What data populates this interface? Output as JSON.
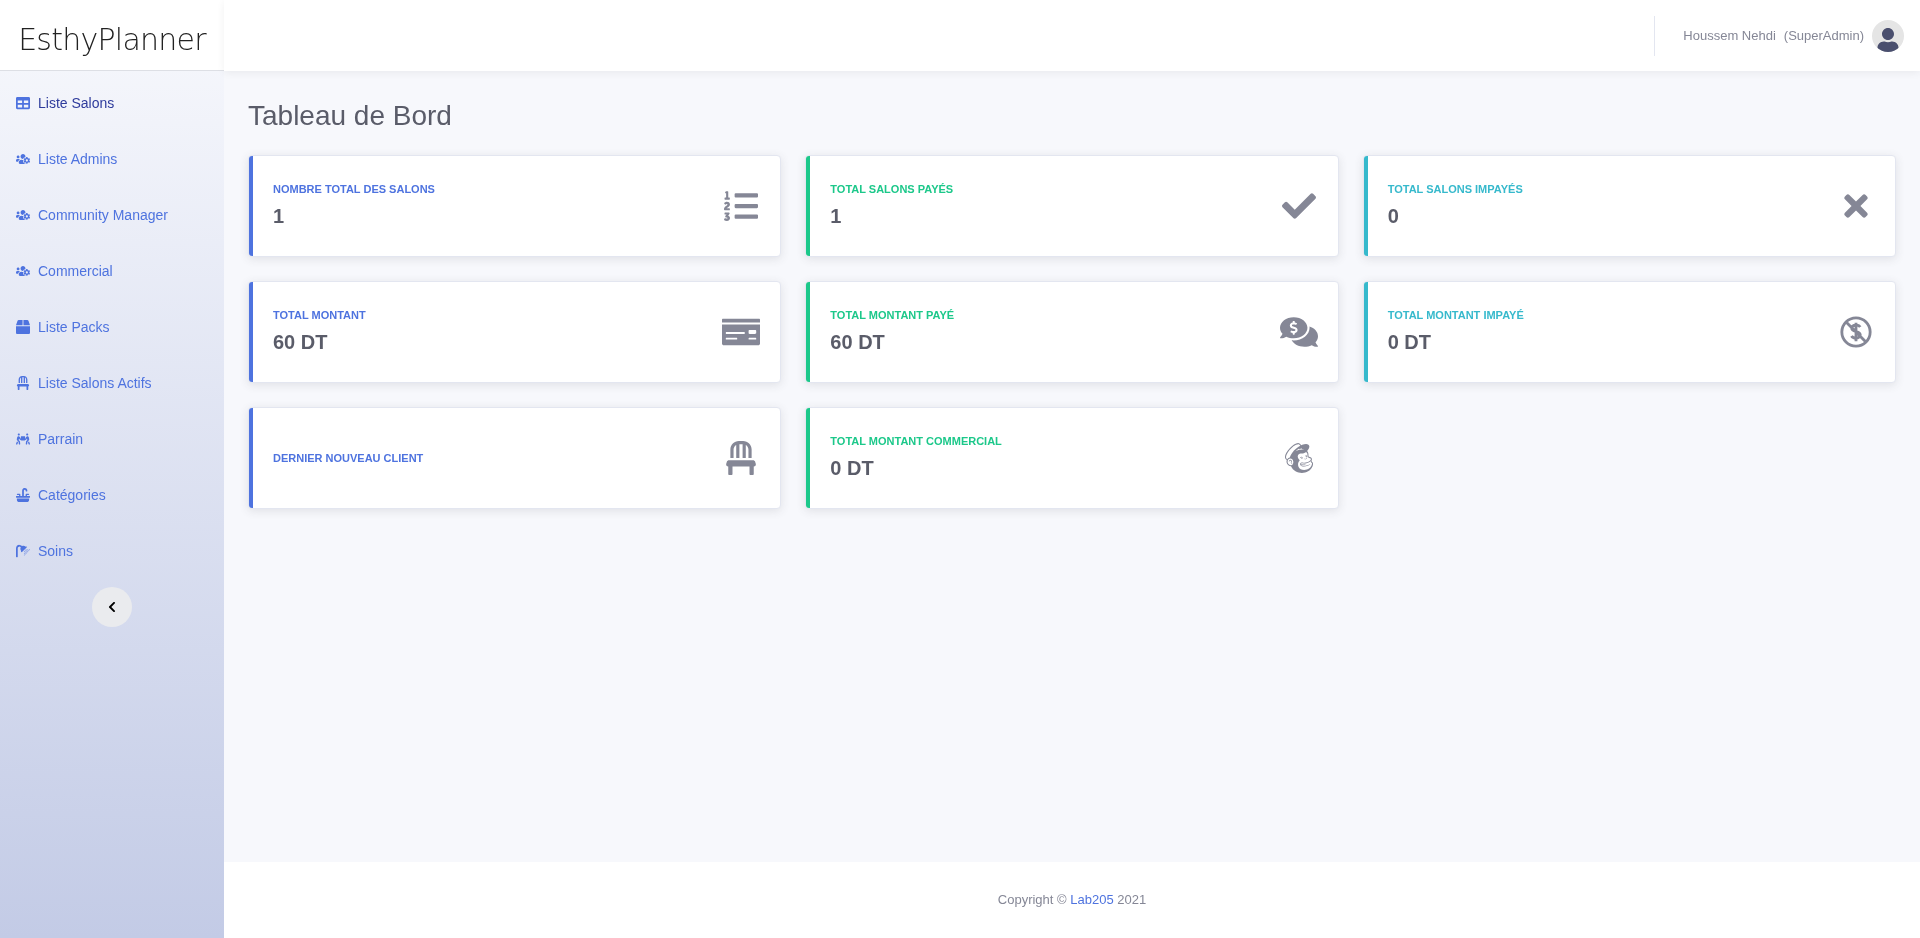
{
  "logo": {
    "text": "EsthyPlanner"
  },
  "sidebar": {
    "items": [
      {
        "label": "Liste Salons",
        "selected": true
      },
      {
        "label": "Liste Admins",
        "selected": false
      },
      {
        "label": "Community Manager",
        "selected": false
      },
      {
        "label": "Commercial",
        "selected": false
      },
      {
        "label": "Liste Packs",
        "selected": false
      },
      {
        "label": "Liste Salons Actifs",
        "selected": false
      },
      {
        "label": "Parrain",
        "selected": false
      },
      {
        "label": "Catégories",
        "selected": false
      },
      {
        "label": "Soins",
        "selected": false
      }
    ]
  },
  "header": {
    "user_name": "Houssem Nehdi",
    "role": "(SuperAdmin)"
  },
  "page_title": "Tableau de Bord",
  "cards": [
    {
      "label": "NOMBRE TOTAL DES SALONS",
      "value": "1",
      "color": "#4e73df"
    },
    {
      "label": "TOTAL SALONS PAYÉS",
      "value": "1",
      "color": "#1cc88a"
    },
    {
      "label": "TOTAL SALONS IMPAYÉS",
      "value": "0",
      "color": "#36b9cc"
    },
    {
      "label": "TOTAL MONTANT",
      "value": "60 DT",
      "color": "#4e73df"
    },
    {
      "label": "TOTAL MONTANT PAYÉ",
      "value": "60 DT",
      "color": "#1cc88a"
    },
    {
      "label": "TOTAL MONTANT IMPAYÉ",
      "value": "0 DT",
      "color": "#36b9cc"
    },
    {
      "label": "DERNIER NOUVEAU CLIENT",
      "color": "#4e73df"
    },
    {
      "label": "TOTAL MONTANT COMMERCIAL",
      "value": "0 DT",
      "color": "#1cc88a"
    }
  ],
  "footer": {
    "text_before": "Copyright ©",
    "link": "Lab205",
    "text_after": "2021"
  }
}
